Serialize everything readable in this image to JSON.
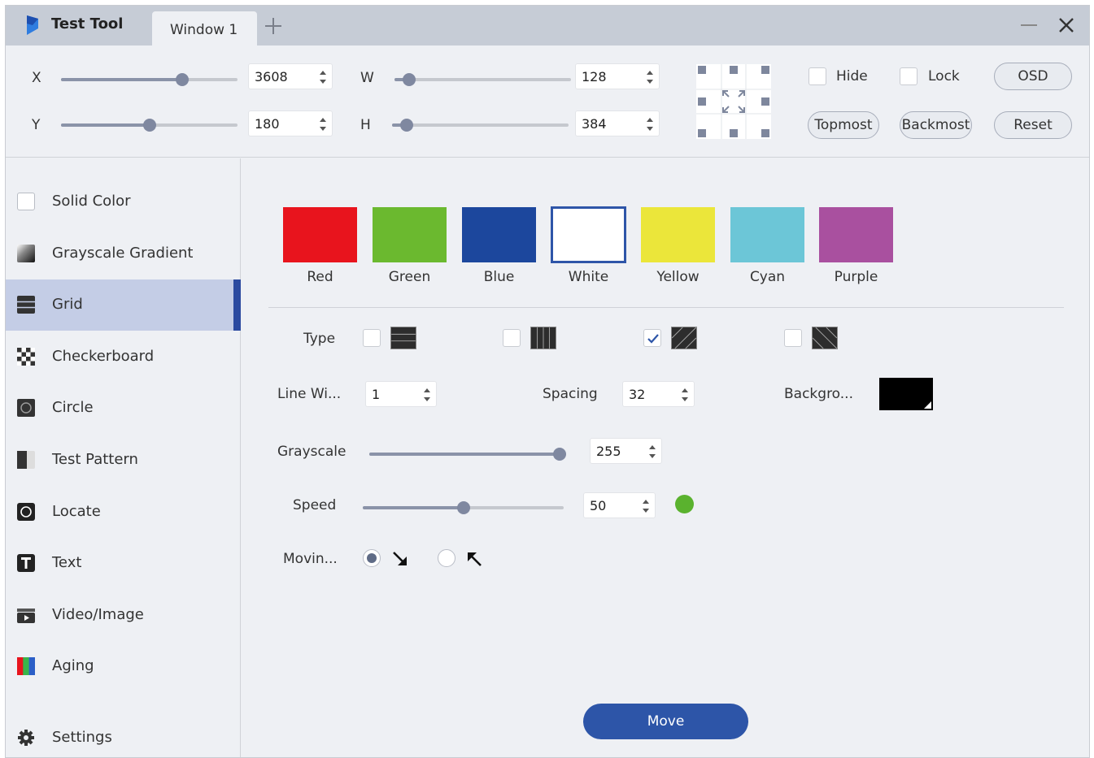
{
  "titlebar": {
    "app_title": "Test Tool",
    "tab_label": "Window 1",
    "icons": [
      "app-logo-icon",
      "plus-icon",
      "minimize-icon",
      "close-icon"
    ]
  },
  "toolbar": {
    "x_label": "X",
    "x_value": "3608",
    "x_slider_fraction": 0.7,
    "y_label": "Y",
    "y_value": "180",
    "y_slider_fraction": 0.5,
    "w_label": "W",
    "w_value": "128",
    "w_slider_fraction": 0.05,
    "h_label": "H",
    "h_value": "384",
    "h_slider_fraction": 0.05,
    "hide_label": "Hide",
    "lock_label": "Lock",
    "osd_label": "OSD",
    "topmost_label": "Topmost",
    "backmost_label": "Backmost",
    "reset_label": "Reset"
  },
  "sidebar": {
    "items": [
      {
        "label": "Solid Color",
        "icon": "solid-color-icon"
      },
      {
        "label": "Grayscale Gradient",
        "icon": "gradient-icon"
      },
      {
        "label": "Grid",
        "icon": "grid-icon"
      },
      {
        "label": "Checkerboard",
        "icon": "checkerboard-icon"
      },
      {
        "label": "Circle",
        "icon": "circle-icon"
      },
      {
        "label": "Test Pattern",
        "icon": "test-pattern-icon"
      },
      {
        "label": "Locate",
        "icon": "locate-icon"
      },
      {
        "label": "Text",
        "icon": "text-icon"
      },
      {
        "label": "Video/Image",
        "icon": "video-image-icon"
      },
      {
        "label": "Aging",
        "icon": "aging-icon"
      },
      {
        "label": "Settings",
        "icon": "gear-icon"
      }
    ],
    "active": "Grid"
  },
  "colors": [
    {
      "label": "Red",
      "hex": "#e8141d"
    },
    {
      "label": "Green",
      "hex": "#6bb92f"
    },
    {
      "label": "Blue",
      "hex": "#1c479d"
    },
    {
      "label": "White",
      "hex": "#ffffff"
    },
    {
      "label": "Yellow",
      "hex": "#ebe63a"
    },
    {
      "label": "Cyan",
      "hex": "#6cc6d7"
    },
    {
      "label": "Purple",
      "hex": "#a9509f"
    }
  ],
  "selected_color": "White",
  "settings": {
    "type_label": "Type",
    "type_options": [
      "horizontal-lines-icon",
      "vertical-lines-icon",
      "diagonal-right-icon",
      "diagonal-left-icon"
    ],
    "type_selected": "diagonal-right-icon",
    "line_width_label": "Line Wi...",
    "line_width_value": "1",
    "spacing_label": "Spacing",
    "spacing_value": "32",
    "background_label": "Backgro...",
    "background_color": "#000000",
    "grayscale_label": "Grayscale",
    "grayscale_value": "255",
    "grayscale_fraction": 1.0,
    "speed_label": "Speed",
    "speed_value": "50",
    "speed_fraction": 0.5,
    "speed_indicator_color": "#5ab22e",
    "moving_label": "Movin...",
    "moving_options": [
      "arrow-down-right-icon",
      "arrow-up-left-icon"
    ],
    "moving_selected": "arrow-down-right-icon",
    "move_button": "Move"
  }
}
